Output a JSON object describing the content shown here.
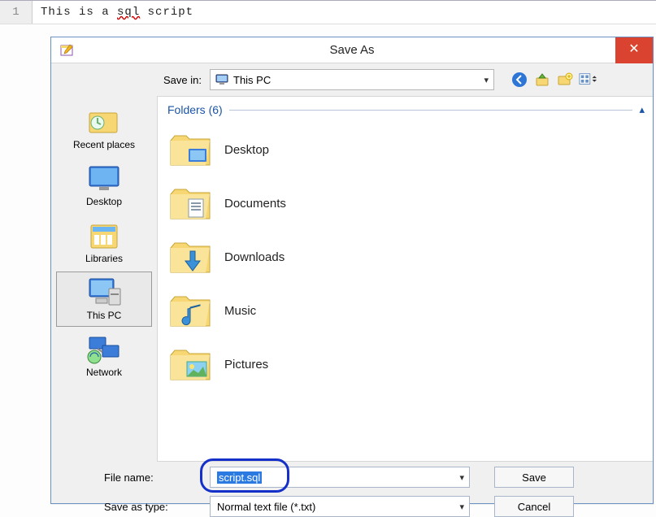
{
  "editor": {
    "line_number": "1",
    "code_prefix": "This is a ",
    "code_sql": "sql",
    "code_suffix": " script"
  },
  "dialog": {
    "title": "Save As",
    "save_in_label": "Save in:",
    "save_in_value": "This PC",
    "toolbar_icons": {
      "back": "back-icon",
      "up": "up-folder-icon",
      "new_folder": "new-folder-icon",
      "views": "views-icon"
    },
    "places": [
      {
        "key": "recent",
        "label": "Recent places"
      },
      {
        "key": "desktop",
        "label": "Desktop"
      },
      {
        "key": "libraries",
        "label": "Libraries"
      },
      {
        "key": "thispc",
        "label": "This PC",
        "selected": true
      },
      {
        "key": "network",
        "label": "Network"
      }
    ],
    "section": {
      "title": "Folders",
      "count": "6"
    },
    "folders": [
      {
        "key": "desktop",
        "label": "Desktop"
      },
      {
        "key": "documents",
        "label": "Documents"
      },
      {
        "key": "downloads",
        "label": "Downloads"
      },
      {
        "key": "music",
        "label": "Music"
      },
      {
        "key": "pictures",
        "label": "Pictures"
      }
    ],
    "filename_label": "File name:",
    "filename_value": "script.sql",
    "saveastype_label": "Save as type:",
    "saveastype_value": "Normal text file (*.txt)",
    "save_btn": "Save",
    "cancel_btn": "Cancel"
  }
}
